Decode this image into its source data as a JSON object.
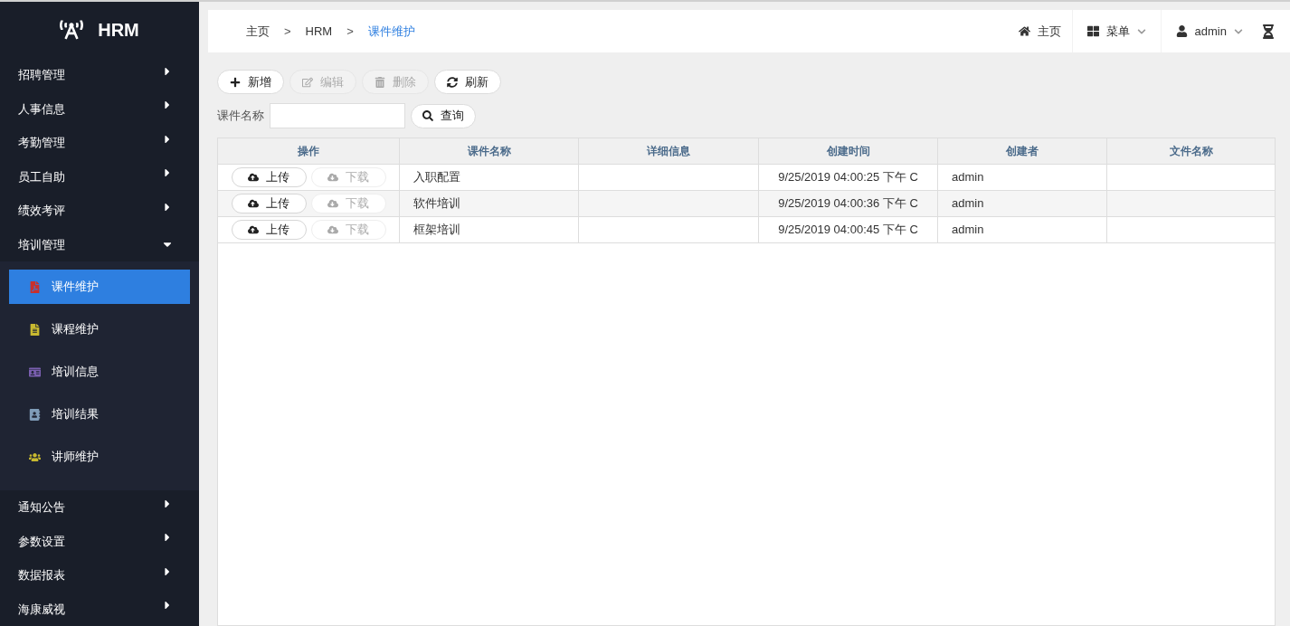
{
  "sidebar": {
    "logo": "HRM",
    "menu": [
      {
        "label": "招聘管理",
        "expanded": false
      },
      {
        "label": "人事信息",
        "expanded": false
      },
      {
        "label": "考勤管理",
        "expanded": false
      },
      {
        "label": "员工自助",
        "expanded": false
      },
      {
        "label": "绩效考评",
        "expanded": false
      },
      {
        "label": "培训管理",
        "expanded": true,
        "children": [
          {
            "label": "课件维护",
            "selected": true
          },
          {
            "label": "课程维护",
            "selected": false
          },
          {
            "label": "培训信息",
            "selected": false
          },
          {
            "label": "培训结果",
            "selected": false
          },
          {
            "label": "讲师维护",
            "selected": false
          }
        ]
      },
      {
        "label": "通知公告",
        "expanded": false
      },
      {
        "label": "参数设置",
        "expanded": false
      },
      {
        "label": "数据报表",
        "expanded": false
      },
      {
        "label": "海康威视",
        "expanded": false
      }
    ]
  },
  "breadcrumb": [
    "主页",
    "HRM",
    "课件维护"
  ],
  "breadcrumb_separator": ">",
  "header": {
    "home": "主页",
    "menu": "菜单",
    "user": "admin"
  },
  "toolbar": [
    {
      "kind": "add",
      "label": "新增",
      "disabled": false
    },
    {
      "kind": "edit",
      "label": "编辑",
      "disabled": true
    },
    {
      "kind": "delete",
      "label": "删除",
      "disabled": true
    },
    {
      "kind": "refresh",
      "label": "刷新",
      "disabled": false
    }
  ],
  "search": {
    "label": "课件名称",
    "button": "查询"
  },
  "table": {
    "columns": [
      "操作",
      "课件名称",
      "详细信息",
      "创建时间",
      "创建者",
      "文件名称"
    ],
    "rows": [
      {
        "cells": [
          {
            "upload": {
              "label": "上传",
              "disabled": false
            },
            "download": {
              "label": "下载",
              "disabled": true
            }
          },
          "入职配置",
          "",
          "9/25/2019 04:00:25 下午 C",
          "admin",
          ""
        ]
      },
      {
        "cells": [
          {
            "upload": {
              "label": "上传",
              "disabled": false
            },
            "download": {
              "label": "下载",
              "disabled": true
            }
          },
          "软件培训",
          "",
          "9/25/2019 04:00:36 下午 C",
          "admin",
          ""
        ]
      },
      {
        "cells": [
          {
            "upload": {
              "label": "上传",
              "disabled": false
            },
            "download": {
              "label": "下载",
              "disabled": true
            }
          },
          "框架培训",
          "",
          "9/25/2019 04:00:45 下午 C",
          "admin",
          ""
        ]
      }
    ]
  }
}
